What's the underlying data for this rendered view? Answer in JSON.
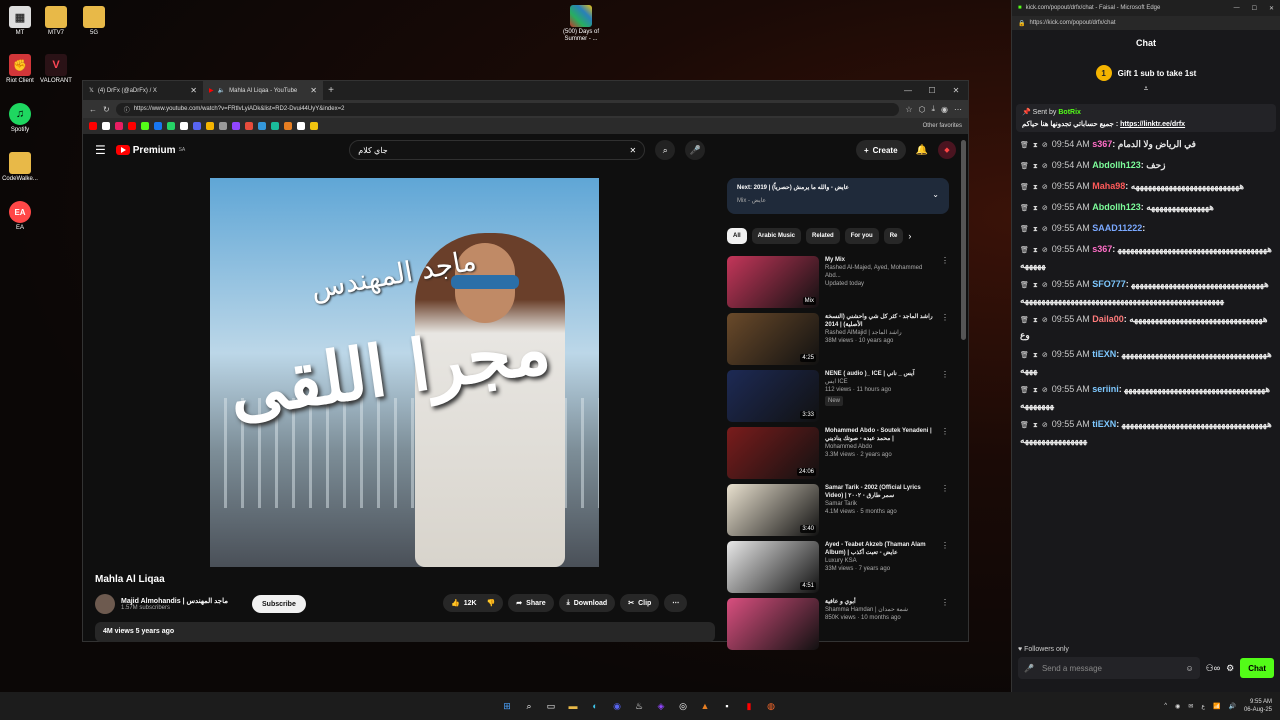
{
  "desktop": {
    "icons": [
      {
        "label": "MT",
        "glyph": "▦",
        "color": "#dddddd"
      },
      {
        "label": "MTV7",
        "glyph": "▬",
        "color": "#e8b948"
      },
      {
        "label": "5G",
        "glyph": "▬",
        "color": "#e8b948"
      },
      {
        "label": "Riot Client",
        "glyph": "✊",
        "color": "#d13639"
      },
      {
        "label": "VALORANT",
        "glyph": "V",
        "color": "#ff4655"
      },
      {
        "label": "Spotify",
        "glyph": "♫",
        "color": "#1ed760"
      },
      {
        "label": "CodeWalke...",
        "glyph": "▬",
        "color": "#e8b948"
      },
      {
        "label": "EA",
        "glyph": "EA",
        "color": "#ff4747"
      },
      {
        "label": "(500) Days of Summer - ...",
        "glyph": "▦",
        "color": "#c0392b"
      }
    ]
  },
  "browser": {
    "tabs": [
      {
        "label": "(4) DrFx (@aDrFx) / X"
      },
      {
        "label": "Mahla Al Liqaa - YouTube"
      }
    ],
    "url": "https://www.youtube.com/watch?v=FRtlvLyiADk&list=RD2-Dvui44UyY&index=2",
    "other_favorites": "Other favorites"
  },
  "youtube": {
    "logo": "Premium",
    "region": "SA",
    "search_query": "جاي كلام",
    "create_label": "Create",
    "video": {
      "title": "Mahla Al Liqaa",
      "channel": "Majid Almohandis | ماجد المهندس",
      "subscribers": "1.57M subscribers",
      "subscribe_label": "Subscribe",
      "likes": "12K",
      "share_label": "Share",
      "download_label": "Download",
      "clip_label": "Clip",
      "views_date": "4M views  5 years ago",
      "art_title": "مجرا اللقى",
      "art_signature": "ماجد المهندس"
    },
    "next": {
      "title": "Next: 2019 | (حصرياً) عايض - والله ما يرمش",
      "subtitle": "Mix - عايض"
    },
    "chips": [
      "All",
      "Arabic Music",
      "Related",
      "For you",
      "Re"
    ],
    "recommendations": [
      {
        "title": "My Mix",
        "meta1": "Rashed Al-Majed, Ayed, Mohammed Abd...",
        "meta2": "Updated today",
        "duration": "Mix",
        "thumb": "#c4365a",
        "badge": ""
      },
      {
        "title": "راشد الماجد - كثر كل شي واحشني (النسخة الأصلية) | 2014",
        "meta1": "Rashed AlMajid | راشد الماجد",
        "meta2": "38M views · 10 years ago",
        "duration": "4:25",
        "thumb": "#6a4a2a",
        "badge": ""
      },
      {
        "title": "NENE ( audio )_ ICE | آيس _ ناني",
        "meta1": "ايس ICE",
        "meta2": "112 views · 11 hours ago",
        "duration": "3:33",
        "thumb": "#1d2a55",
        "badge": "New"
      },
      {
        "title": "Mohammed Abdo - Soutek Yenadeni | محمد عبده - صوتك يناديني |",
        "meta1": "Mohammed Abdo",
        "meta2": "3.3M views · 2 years ago",
        "duration": "24:06",
        "thumb": "#7a1c1c",
        "badge": ""
      },
      {
        "title": "Samar Tarik - 2002 (Official Lyrics Video) | سمر طارق - ٢٠٠٢",
        "meta1": "Samar Tarik",
        "meta2": "4.1M views · 5 months ago",
        "duration": "3:40",
        "thumb": "#e9e1cf",
        "badge": ""
      },
      {
        "title": "Ayed - Teabet Akzeb (Thaman Alam Album) | عايض - تعبت أكذب",
        "meta1": "Luxury KSA",
        "meta2": "33M views · 7 years ago",
        "duration": "4:51",
        "thumb": "#e8e8e8",
        "badge": ""
      },
      {
        "title": "أبوي و عافية",
        "meta1": "Shamma Hamdan | شمة حمدان",
        "meta2": "850K views · 10 months ago",
        "duration": "",
        "thumb": "#d94f7f",
        "badge": ""
      }
    ]
  },
  "kick": {
    "window_title": "kick.com/popout/drfx/chat - Faisal - Microsoft Edge",
    "url": "https://kick.com/popout/drfx/chat",
    "header": "Chat",
    "gift_label": "Gift 1 sub to take 1st",
    "pinned": {
      "sent_by": "Sent by",
      "bot": "BotRix",
      "text": "جميع حساباتي تجدونها هنا حياكم",
      "link": "https://linktr.ee/drfx"
    },
    "messages": [
      {
        "time": "09:54 AM",
        "user": "s367",
        "color": "#ff6ec7",
        "text": "في الرياض ولا الدمام"
      },
      {
        "time": "09:54 AM",
        "user": "Abdollh123",
        "color": "#7cfc9a",
        "text": "زحف"
      },
      {
        "time": "09:55 AM",
        "user": "Maha98",
        "color": "#ff5a5a",
        "text": "ههههههههههههههههههههههههههه"
      },
      {
        "time": "09:55 AM",
        "user": "Abdollh123",
        "color": "#7cfc9a",
        "text": "هههههههههههههههه"
      },
      {
        "time": "09:55 AM",
        "user": "SAAD11222",
        "color": "#7aa8ff",
        "text": ""
      },
      {
        "time": "09:55 AM",
        "user": "s367",
        "color": "#ff6ec7",
        "text": "ههههههههههههههههههههههههههههههههههههههههههه"
      },
      {
        "time": "09:55 AM",
        "user": "SFO777",
        "color": "#7ec8ff",
        "text": "هههههههههههههههههههههههههههههههههههههههههههههههههههههههههههههههههههههههههههههههههه"
      },
      {
        "time": "09:55 AM",
        "user": "Daila00",
        "color": "#ff7b7b",
        "text": "ههههههههههههههههههههههههههههههههه وع"
      },
      {
        "time": "09:55 AM",
        "user": "tiEXN",
        "color": "#7ec8ff",
        "text": "هههههههههههههههههههههههههههههههههههههههه"
      },
      {
        "time": "09:55 AM",
        "user": "seriini",
        "color": "#7ec8ff",
        "text": "ههههههههههههههههههههههههههههههههههههههههههه"
      },
      {
        "time": "09:55 AM",
        "user": "tiEXN",
        "color": "#7ec8ff",
        "text": "هههههههههههههههههههههههههههههههههههههههههههههههههههه"
      }
    ],
    "followers_only": "Followers only",
    "placeholder": "Send a message",
    "chat_btn": "Chat"
  },
  "taskbar": {
    "time": "9:55 AM",
    "date": "06-Aug-25",
    "lang": "ع"
  }
}
